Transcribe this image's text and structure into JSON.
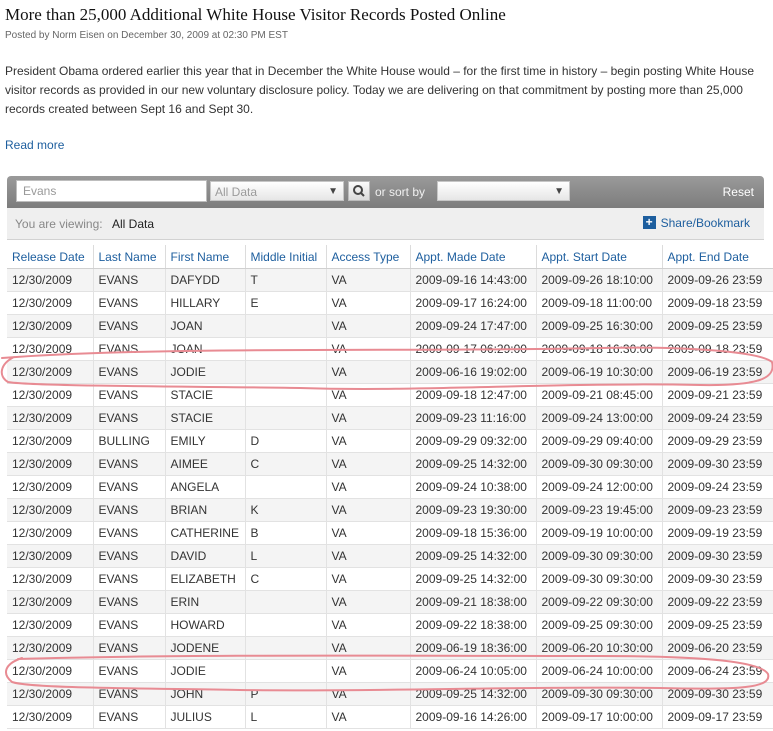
{
  "article": {
    "title": "More than 25,000 Additional White House Visitor Records Posted Online",
    "byline": "Posted by Norm Eisen on December 30, 2009 at 02:30 PM EST",
    "intro": "President Obama ordered earlier this year that in December the White House would – for the first time in history – begin posting White House visitor records as provided in our new voluntary disclosure policy. Today we are delivering on that commitment by posting more than 25,000 records created between Sept 16 and Sept 30.",
    "read_more": "Read more"
  },
  "toolbar": {
    "search_value": "Evans",
    "filter_selected": "All Data",
    "sort_label": "or sort by",
    "sort_selected": "",
    "reset_label": "Reset"
  },
  "viewbar": {
    "viewing_label": "You are viewing:",
    "viewing_value": "All Data",
    "share_label": "Share/Bookmark"
  },
  "table": {
    "headers": [
      "Release Date",
      "Last Name",
      "First Name",
      "Middle Initial",
      "Access Type",
      "Appt. Made Date",
      "Appt. Start Date",
      "Appt. End Date"
    ],
    "rows": [
      [
        "12/30/2009",
        "EVANS",
        "DAFYDD",
        "T",
        "VA",
        "2009-09-16 14:43:00",
        "2009-09-26 18:10:00",
        "2009-09-26 23:59"
      ],
      [
        "12/30/2009",
        "EVANS",
        "HILLARY",
        "E",
        "VA",
        "2009-09-17 16:24:00",
        "2009-09-18 11:00:00",
        "2009-09-18 23:59"
      ],
      [
        "12/30/2009",
        "EVANS",
        "JOAN",
        "",
        "VA",
        "2009-09-24 17:47:00",
        "2009-09-25 16:30:00",
        "2009-09-25 23:59"
      ],
      [
        "12/30/2009",
        "EVANS",
        "JOAN",
        "",
        "VA",
        "2009-09-17 06:29:00",
        "2009-09-18 16:30:00",
        "2009-09-18 23:59"
      ],
      [
        "12/30/2009",
        "EVANS",
        "JODIE",
        "",
        "VA",
        "2009-06-16 19:02:00",
        "2009-06-19 10:30:00",
        "2009-06-19 23:59"
      ],
      [
        "12/30/2009",
        "EVANS",
        "STACIE",
        "",
        "VA",
        "2009-09-18 12:47:00",
        "2009-09-21 08:45:00",
        "2009-09-21 23:59"
      ],
      [
        "12/30/2009",
        "EVANS",
        "STACIE",
        "",
        "VA",
        "2009-09-23 11:16:00",
        "2009-09-24 13:00:00",
        "2009-09-24 23:59"
      ],
      [
        "12/30/2009",
        "BULLING",
        "EMILY",
        "D",
        "VA",
        "2009-09-29 09:32:00",
        "2009-09-29 09:40:00",
        "2009-09-29 23:59"
      ],
      [
        "12/30/2009",
        "EVANS",
        "AIMEE",
        "C",
        "VA",
        "2009-09-25 14:32:00",
        "2009-09-30 09:30:00",
        "2009-09-30 23:59"
      ],
      [
        "12/30/2009",
        "EVANS",
        "ANGELA",
        "",
        "VA",
        "2009-09-24 10:38:00",
        "2009-09-24 12:00:00",
        "2009-09-24 23:59"
      ],
      [
        "12/30/2009",
        "EVANS",
        "BRIAN",
        "K",
        "VA",
        "2009-09-23 19:30:00",
        "2009-09-23 19:45:00",
        "2009-09-23 23:59"
      ],
      [
        "12/30/2009",
        "EVANS",
        "CATHERINE",
        "B",
        "VA",
        "2009-09-18 15:36:00",
        "2009-09-19 10:00:00",
        "2009-09-19 23:59"
      ],
      [
        "12/30/2009",
        "EVANS",
        "DAVID",
        "L",
        "VA",
        "2009-09-25 14:32:00",
        "2009-09-30 09:30:00",
        "2009-09-30 23:59"
      ],
      [
        "12/30/2009",
        "EVANS",
        "ELIZABETH",
        "C",
        "VA",
        "2009-09-25 14:32:00",
        "2009-09-30 09:30:00",
        "2009-09-30 23:59"
      ],
      [
        "12/30/2009",
        "EVANS",
        "ERIN",
        "",
        "VA",
        "2009-09-21 18:38:00",
        "2009-09-22 09:30:00",
        "2009-09-22 23:59"
      ],
      [
        "12/30/2009",
        "EVANS",
        "HOWARD",
        "",
        "VA",
        "2009-09-22 18:38:00",
        "2009-09-25 09:30:00",
        "2009-09-25 23:59"
      ],
      [
        "12/30/2009",
        "EVANS",
        "JODENE",
        "",
        "VA",
        "2009-06-19 18:36:00",
        "2009-06-20 10:30:00",
        "2009-06-20 23:59"
      ],
      [
        "12/30/2009",
        "EVANS",
        "JODIE",
        "",
        "VA",
        "2009-06-24 10:05:00",
        "2009-06-24 10:00:00",
        "2009-06-24 23:59"
      ],
      [
        "12/30/2009",
        "EVANS",
        "JOHN",
        "P",
        "VA",
        "2009-09-25 14:32:00",
        "2009-09-30 09:30:00",
        "2009-09-30 23:59"
      ],
      [
        "12/30/2009",
        "EVANS",
        "JULIUS",
        "L",
        "VA",
        "2009-09-16 14:26:00",
        "2009-09-17 10:00:00",
        "2009-09-17 23:59"
      ]
    ]
  },
  "colors": {
    "link": "#1d5e9e",
    "toolbar": "#8a8a8a",
    "annotation": "#e88b93"
  }
}
